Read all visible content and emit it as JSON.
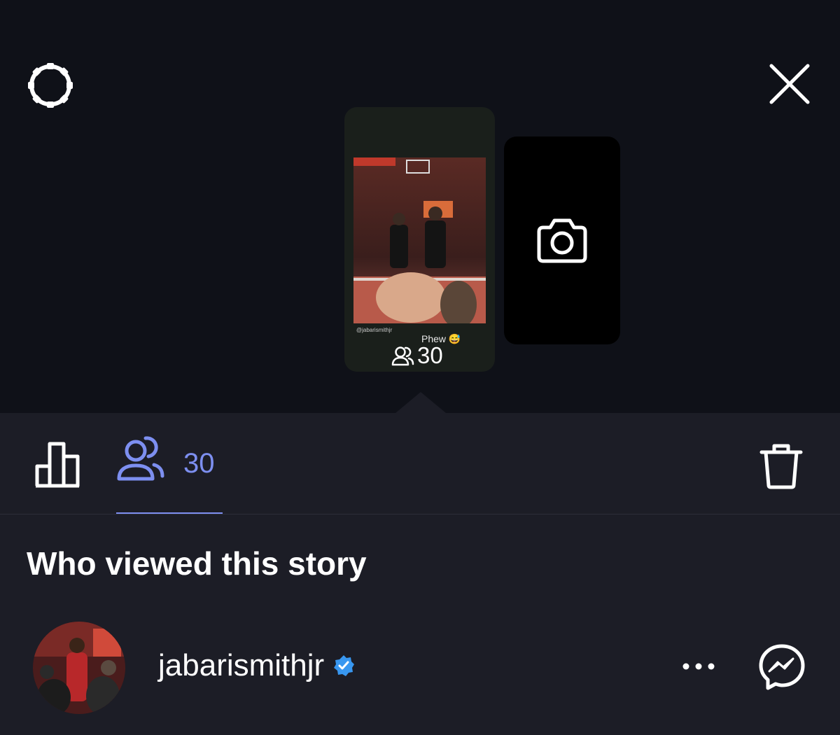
{
  "icons": {
    "settings": "gear-icon",
    "close": "close-icon",
    "add_story": "camera-icon",
    "insights": "bar-chart-icon",
    "viewers": "people-icon",
    "delete": "trash-icon",
    "more": "more-horizontal-icon",
    "message": "messenger-icon",
    "verified": "verified-badge-icon"
  },
  "story_preview": {
    "handle": "@jabarismithjr",
    "caption": "Phew 😅",
    "view_count": "30"
  },
  "tabs": {
    "viewers_count": "30"
  },
  "viewers_section": {
    "title": "Who viewed this story",
    "viewers": [
      {
        "username": "jabarismithjr",
        "verified": true
      }
    ]
  },
  "colors": {
    "accent": "#7d8ff0",
    "verified": "#3897f0",
    "panel_bg": "#1c1d26",
    "top_bg": "#0f1118"
  }
}
